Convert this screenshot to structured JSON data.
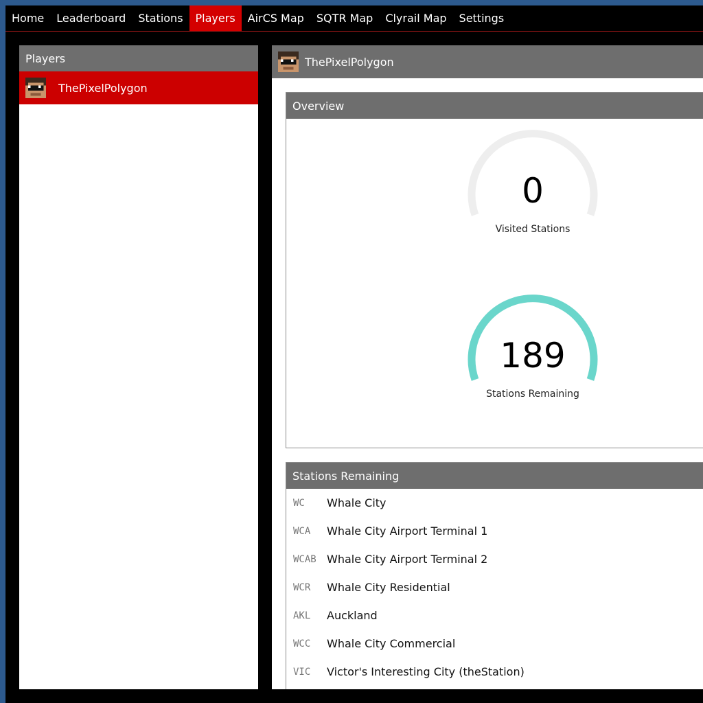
{
  "nav": {
    "items": [
      {
        "label": "Home"
      },
      {
        "label": "Leaderboard"
      },
      {
        "label": "Stations"
      },
      {
        "label": "Players"
      },
      {
        "label": "AirCS Map"
      },
      {
        "label": "SQTR Map"
      },
      {
        "label": "Clyrail Map"
      },
      {
        "label": "Settings"
      }
    ],
    "active": "Players",
    "accent_color": "#d40000"
  },
  "players_panel": {
    "title": "Players",
    "selected_player": {
      "name": "ThePixelPolygon",
      "avatar_icon": "player-avatar-icon"
    }
  },
  "player_view": {
    "name": "ThePixelPolygon",
    "overview": {
      "title": "Overview",
      "visited": {
        "value": "0",
        "label": "Visited Stations",
        "fraction": 0,
        "color": "#eeeeee"
      },
      "remaining": {
        "value": "189",
        "label": "Stations Remaining",
        "fraction": 1,
        "color": "#6ad6cb"
      }
    },
    "stations_remaining": {
      "title": "Stations Remaining",
      "rows": [
        {
          "code": "WC",
          "name": "Whale City"
        },
        {
          "code": "WCA",
          "name": "Whale City Airport Terminal 1"
        },
        {
          "code": "WCAB",
          "name": "Whale City Airport Terminal 2"
        },
        {
          "code": "WCR",
          "name": "Whale City Residential"
        },
        {
          "code": "AKL",
          "name": "Auckland"
        },
        {
          "code": "WCC",
          "name": "Whale City Commercial"
        },
        {
          "code": "VIC",
          "name": "Victor's Interesting City (theStation)"
        }
      ]
    }
  }
}
